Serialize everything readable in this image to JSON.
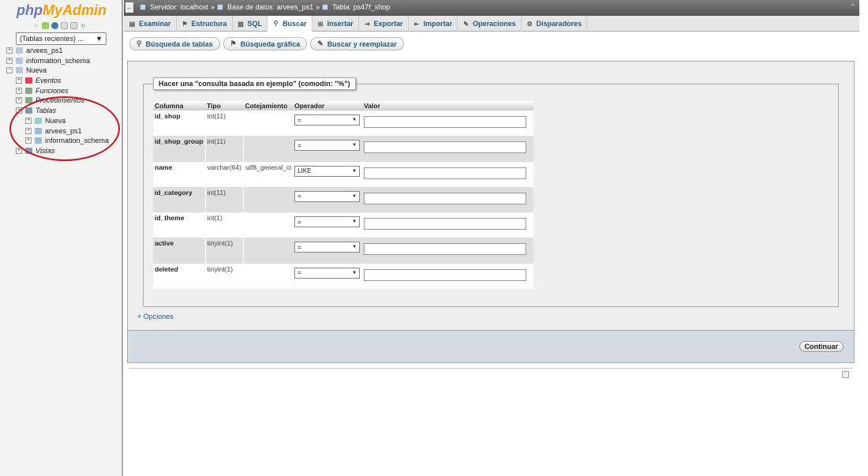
{
  "app": {
    "logo_part1": "php",
    "logo_part2": "MyAdmin"
  },
  "sidebar": {
    "recent_label": "(Tablas recientes) ...",
    "tree": [
      {
        "label": "arvees_ps1",
        "level": 0,
        "italic": false
      },
      {
        "label": "information_schema",
        "level": 0,
        "italic": false
      },
      {
        "label": "Nueva",
        "level": 0,
        "italic": false
      },
      {
        "label": "Eventos",
        "level": 1,
        "italic": true
      },
      {
        "label": "Funciones",
        "level": 1,
        "italic": true
      },
      {
        "label": "Procedimientos",
        "level": 1,
        "italic": true
      },
      {
        "label": "Tablas",
        "level": 1,
        "italic": true
      },
      {
        "label": "Nueva",
        "level": 2,
        "italic": false
      },
      {
        "label": "arvees_ps1",
        "level": 2,
        "italic": false
      },
      {
        "label": "information_schema",
        "level": 2,
        "italic": false
      },
      {
        "label": "Vistas",
        "level": 1,
        "italic": true
      }
    ]
  },
  "breadcrumb": {
    "server": "Servidor: localhost",
    "sep": "»",
    "database": "Base de datos: arvees_ps1",
    "table": "Tabla: ps47f_shop"
  },
  "tabs": [
    {
      "label": "Examinar",
      "icon": "browse-icon"
    },
    {
      "label": "Estructura",
      "icon": "structure-icon"
    },
    {
      "label": "SQL",
      "icon": "sql-icon"
    },
    {
      "label": "Buscar",
      "icon": "search-icon",
      "active": true
    },
    {
      "label": "Insertar",
      "icon": "insert-icon"
    },
    {
      "label": "Exportar",
      "icon": "export-icon"
    },
    {
      "label": "Importar",
      "icon": "import-icon"
    },
    {
      "label": "Operaciones",
      "icon": "operations-icon"
    },
    {
      "label": "Disparadores",
      "icon": "triggers-icon"
    }
  ],
  "subtabs": [
    {
      "label": "Búsqueda de tablas",
      "icon": "search-icon"
    },
    {
      "label": "Búsqueda gráfica",
      "icon": "chart-icon"
    },
    {
      "label": "Buscar y reemplazar",
      "icon": "replace-icon"
    }
  ],
  "query": {
    "legend": "Hacer una \"consulta basada en ejemplo\" (comodín: \"%\")",
    "headers": {
      "column": "Columna",
      "type": "Tipo",
      "collation": "Cotejamiento",
      "operator": "Operador",
      "value": "Valor"
    },
    "rows": [
      {
        "column": "id_shop",
        "type": "int(11)",
        "collation": "",
        "operator": "=",
        "value": ""
      },
      {
        "column": "id_shop_group",
        "type": "int(11)",
        "collation": "",
        "operator": "=",
        "value": ""
      },
      {
        "column": "name",
        "type": "varchar(64)",
        "collation": "utf8_general_ci",
        "operator": "LIKE",
        "value": ""
      },
      {
        "column": "id_category",
        "type": "int(11)",
        "collation": "",
        "operator": "=",
        "value": ""
      },
      {
        "column": "id_theme",
        "type": "int(1)",
        "collation": "",
        "operator": "=",
        "value": ""
      },
      {
        "column": "active",
        "type": "tinyint(1)",
        "collation": "",
        "operator": "=",
        "value": ""
      },
      {
        "column": "deleted",
        "type": "tinyint(1)",
        "collation": "",
        "operator": "=",
        "value": ""
      }
    ],
    "options_label": "+ Opciones",
    "submit_label": "Continuar"
  },
  "colors": {
    "link": "#235a81",
    "logo_blue": "#6c78af",
    "logo_orange": "#f89c0e",
    "annotation_red": "#c0181c"
  }
}
